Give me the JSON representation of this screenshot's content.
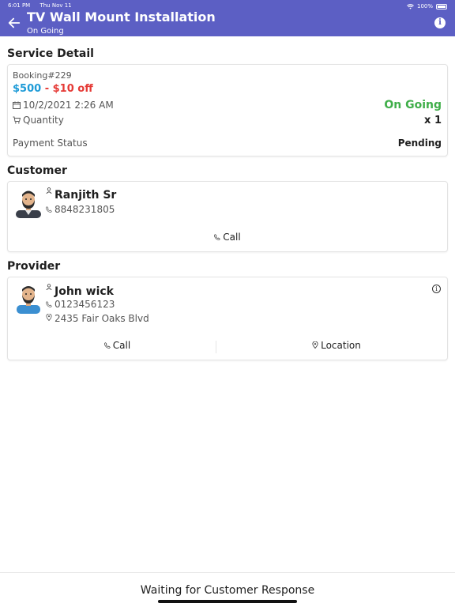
{
  "status_bar": {
    "time": "6:01 PM",
    "date": "Thu Nov 11",
    "battery": "100%"
  },
  "header": {
    "title": "TV Wall Mount Installation",
    "subtitle": "On Going",
    "bg_color": "#5c5fc4"
  },
  "service": {
    "section_title": "Service Detail",
    "booking": "Booking#229",
    "price": "$500",
    "separator": " - ",
    "discount": "$10 off",
    "datetime": "10/2/2021 2:26 AM",
    "status": "On Going",
    "quantity_label": "Quantity",
    "quantity_value": "x 1",
    "payment_label": "Payment Status",
    "payment_value": "Pending",
    "price_color": "#1e9bd7",
    "discount_color": "#e53935",
    "status_color": "#3fae49"
  },
  "customer": {
    "section_title": "Customer",
    "name": "Ranjith Sr",
    "phone": "8848231805",
    "call_label": "Call"
  },
  "provider": {
    "section_title": "Provider",
    "name": "John wick",
    "phone": "0123456123",
    "address": "2435 Fair Oaks Blvd",
    "call_label": "Call",
    "location_label": "Location"
  },
  "footer": {
    "status_text": "Waiting for Customer Response"
  }
}
